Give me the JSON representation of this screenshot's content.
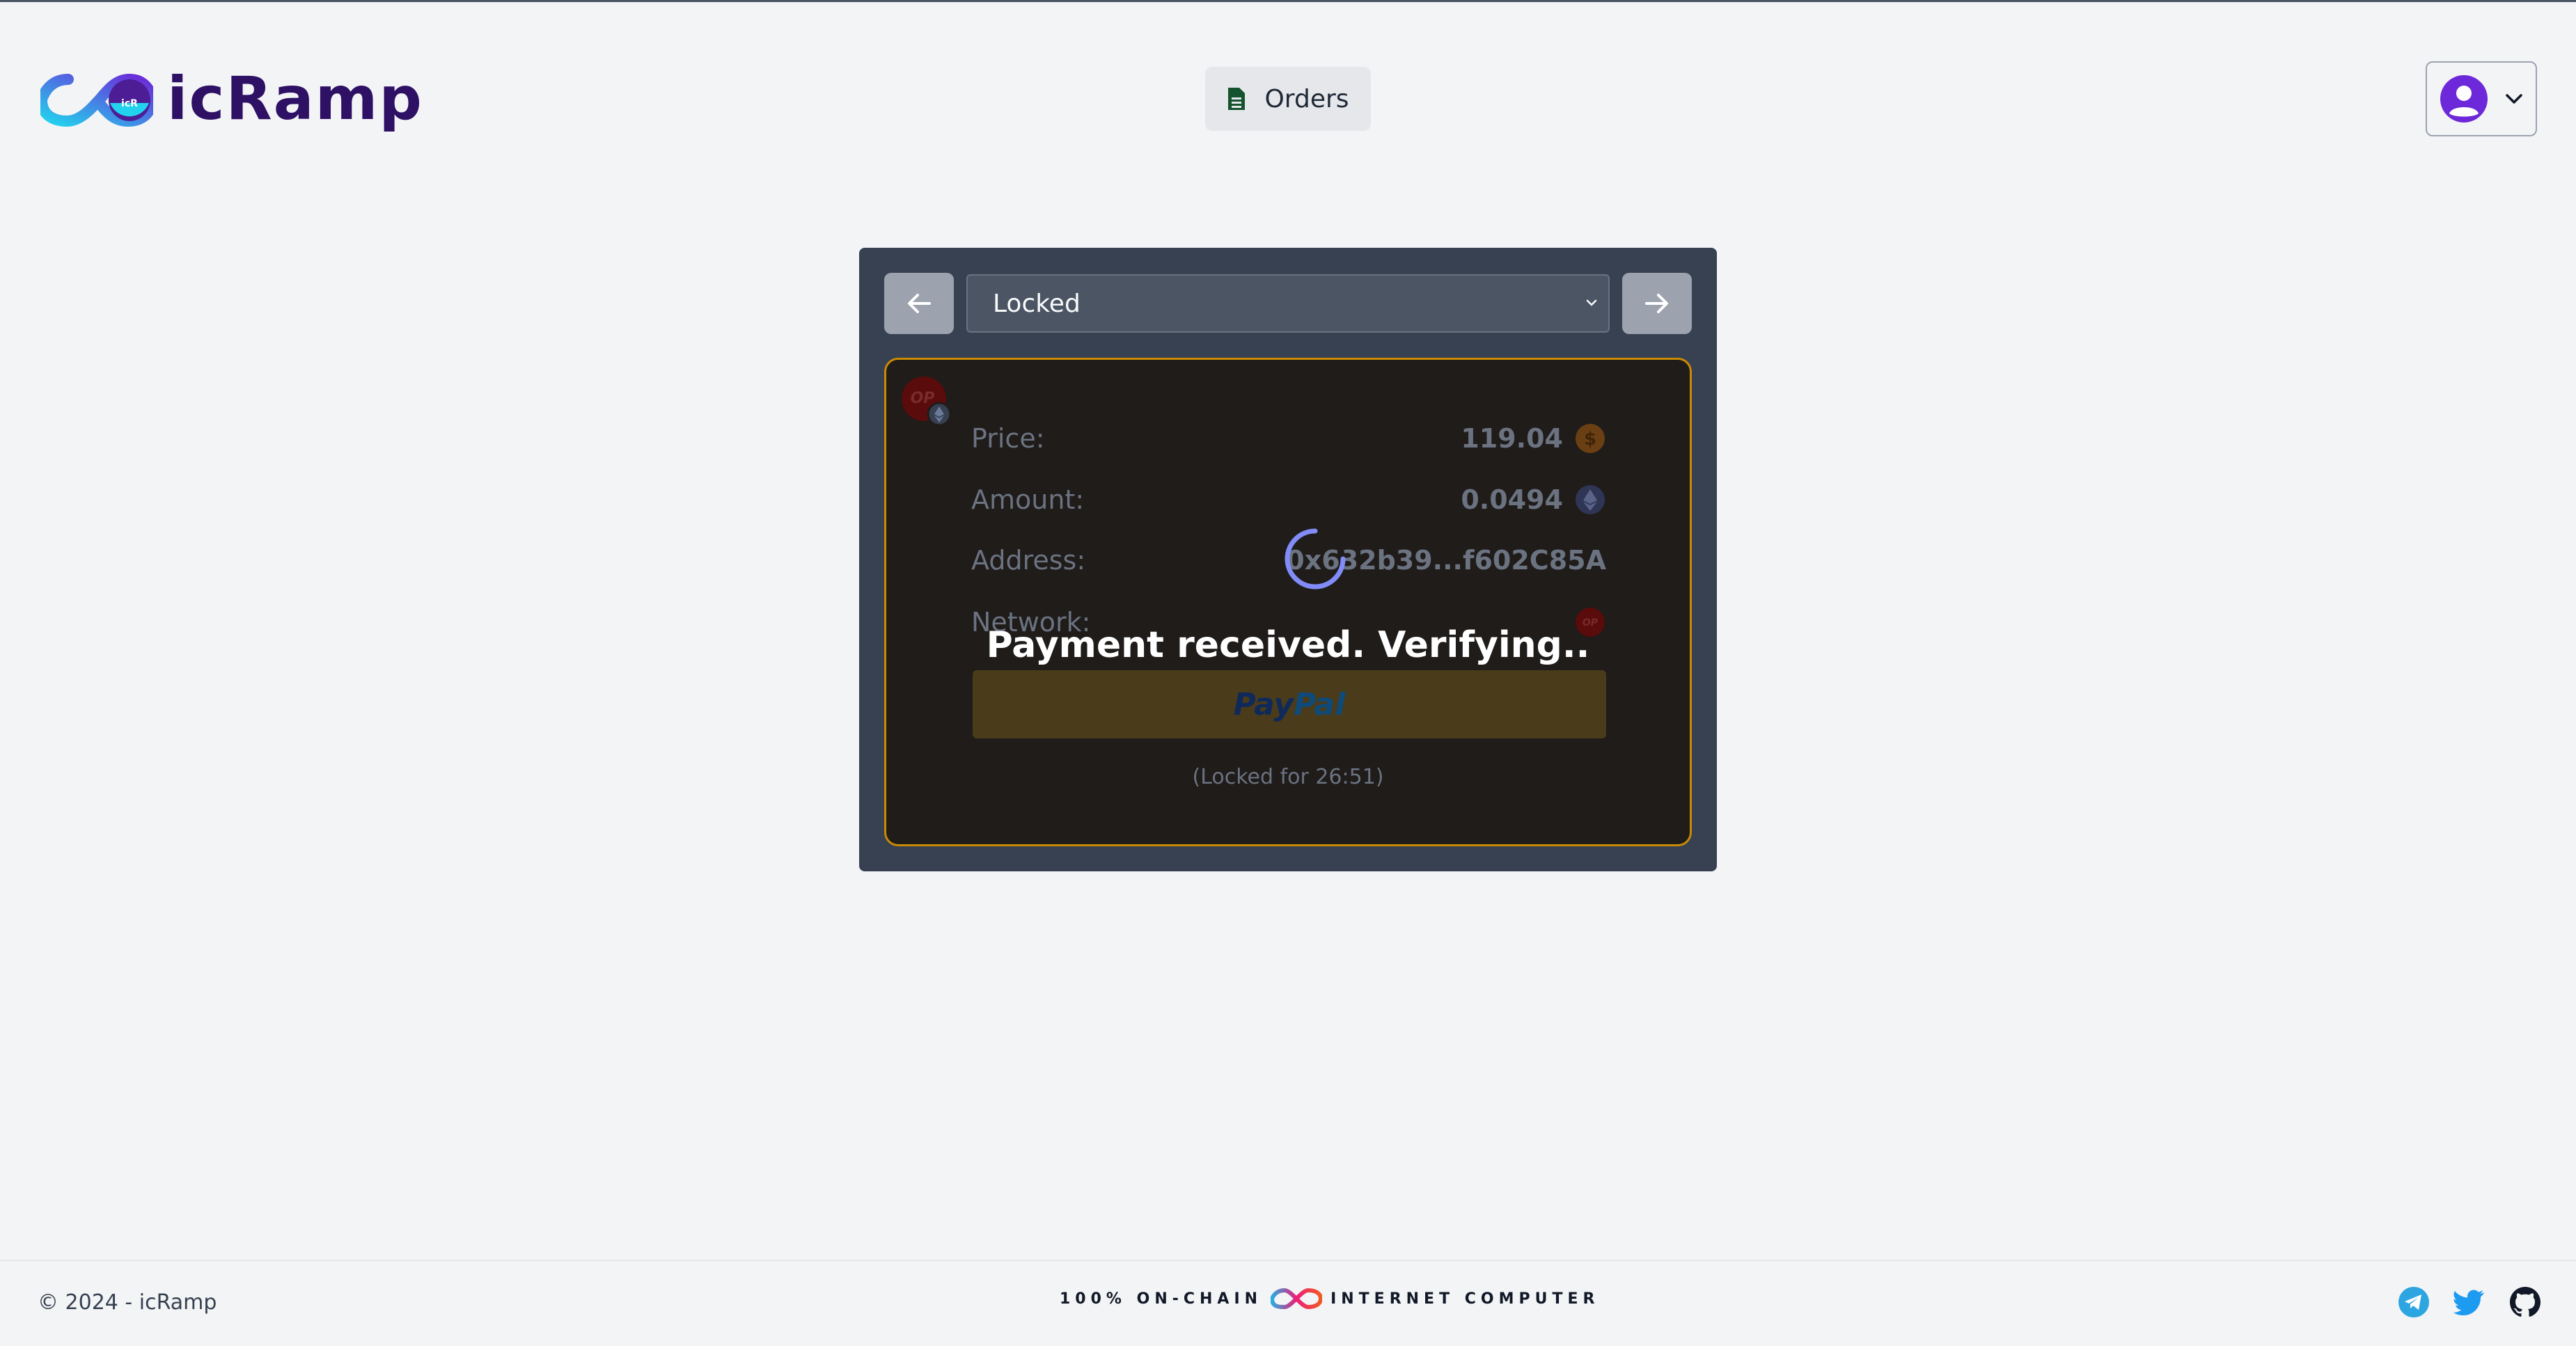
{
  "header": {
    "app_name": "icRamp",
    "orders_label": "Orders"
  },
  "order": {
    "status_selected": "Locked",
    "price_label": "Price:",
    "price_value": "119.04",
    "amount_label": "Amount:",
    "amount_value": "0.0494",
    "address_label": "Address:",
    "address_value": "0x632b39...f602C85A",
    "network_label": "Network:",
    "network_badge": "OP",
    "payment_method": "PayPal",
    "payment_method_pay": "Pay",
    "payment_method_pal": "Pal",
    "locked_note": "(Locked for 26:51)",
    "verify_message": "Payment received. Verifying.."
  },
  "footer": {
    "copyright": "© 2024 - icRamp",
    "onchain_left": "100% ON-CHAIN",
    "onchain_right": "INTERNET COMPUTER"
  },
  "icons": {
    "orders": "document-icon",
    "user": "user-avatar-icon",
    "prev": "arrow-left-icon",
    "next": "arrow-right-icon",
    "price_currency": "dollar-coin-icon",
    "amount_currency": "ethereum-icon",
    "network": "optimism-icon",
    "socials": [
      "telegram-icon",
      "twitter-icon",
      "github-icon"
    ]
  },
  "colors": {
    "brand": "#2e1065",
    "card_border": "#ca8a04",
    "panel": "#374151",
    "spinner": "#818cf8"
  }
}
